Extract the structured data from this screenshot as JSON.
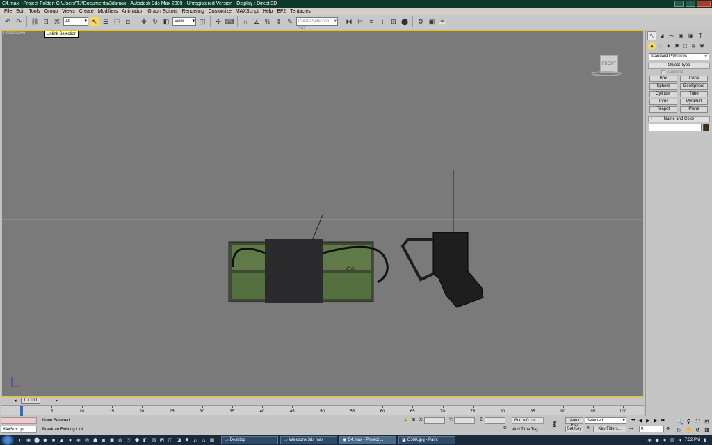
{
  "window": {
    "title": "C4.max    - Project Folder: C:\\Users\\TJ\\Documents\\3dsmax     - Autodesk 3ds Max  2009    - Unregistered Version     - Display : Direct 3D"
  },
  "menu": [
    "File",
    "Edit",
    "Tools",
    "Group",
    "Views",
    "Create",
    "Modifiers",
    "Animation",
    "Graph Editors",
    "Rendering",
    "Customize",
    "MAXScript",
    "Help",
    "BF2",
    "Tentacles"
  ],
  "toolbar": {
    "filter_value": "All",
    "refcoord_value": "View",
    "named_sel_placeholder": "Create Selection Set",
    "tooltip": "Unlink Selection"
  },
  "viewport": {
    "label": "Perspective",
    "viewcube_label": "FRONT"
  },
  "command_panel": {
    "category": "Standard Primitives",
    "object_type_title": "Object Type",
    "autogrid_label": "AutoGrid",
    "buttons": [
      "Box",
      "Cone",
      "Sphere",
      "GeoSphere",
      "Cylinder",
      "Tube",
      "Torus",
      "Pyramid",
      "Teapot",
      "Plane"
    ],
    "name_color_title": "Name and Color",
    "color": "#3a2f18"
  },
  "timeline": {
    "frame_readout": "0 / 100",
    "ticks": [
      "0",
      "5",
      "10",
      "15",
      "20",
      "25",
      "30",
      "35",
      "40",
      "45",
      "50",
      "55",
      "60",
      "65",
      "70",
      "75",
      "80",
      "85",
      "90",
      "95",
      "100"
    ]
  },
  "status": {
    "maxscript_label": "MAXScript.",
    "selection_info": "None Selected",
    "prompt": "Break an Existing Link",
    "x_label": "X:",
    "y_label": "Y:",
    "z_label": "Z:",
    "grid": "Grid = 0.1m",
    "add_time_tag": "Add Time Tag",
    "auto_key": "Auto Key",
    "set_key": "Set Key",
    "key_mode": "Selected",
    "key_filters": "Key Filters...",
    "frame_value": "0"
  },
  "taskbar": {
    "tasks": [
      "Desktop",
      "Weapons 3ds max",
      "C4.max    - Project ...",
      "G36K.jpg - Paint"
    ],
    "clock": "7:32 PM"
  }
}
